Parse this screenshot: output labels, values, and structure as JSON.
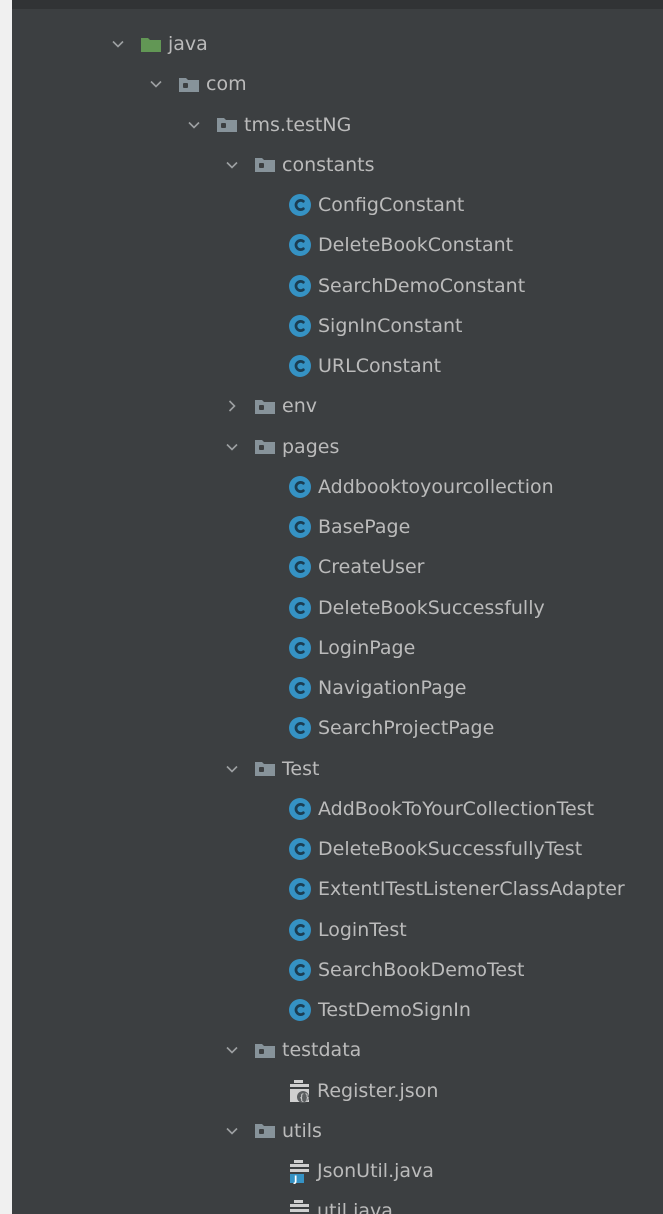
{
  "colors": {
    "background": "#3c3f41",
    "text": "#bbbbbb",
    "source_folder": "#629755",
    "package_folder": "#87939a",
    "class_icon": "#3592c4"
  },
  "tree": [
    {
      "label": "java",
      "kind": "source-folder",
      "depth": 0,
      "expanded": true
    },
    {
      "label": "com",
      "kind": "package",
      "depth": 1,
      "expanded": true
    },
    {
      "label": "tms.testNG",
      "kind": "package",
      "depth": 2,
      "expanded": true
    },
    {
      "label": "constants",
      "kind": "package",
      "depth": 3,
      "expanded": true
    },
    {
      "label": "ConfigConstant",
      "kind": "class",
      "depth": 4
    },
    {
      "label": "DeleteBookConstant",
      "kind": "class",
      "depth": 4
    },
    {
      "label": "SearchDemoConstant",
      "kind": "class",
      "depth": 4
    },
    {
      "label": "SignInConstant",
      "kind": "class",
      "depth": 4
    },
    {
      "label": "URLConstant",
      "kind": "class",
      "depth": 4
    },
    {
      "label": "env",
      "kind": "package",
      "depth": 3,
      "expanded": false
    },
    {
      "label": "pages",
      "kind": "package",
      "depth": 3,
      "expanded": true
    },
    {
      "label": "Addbooktoyourcollection",
      "kind": "class",
      "depth": 4
    },
    {
      "label": "BasePage",
      "kind": "class",
      "depth": 4
    },
    {
      "label": "CreateUser",
      "kind": "class",
      "depth": 4
    },
    {
      "label": "DeleteBookSuccessfully",
      "kind": "class",
      "depth": 4
    },
    {
      "label": "LoginPage",
      "kind": "class",
      "depth": 4
    },
    {
      "label": "NavigationPage",
      "kind": "class",
      "depth": 4
    },
    {
      "label": "SearchProjectPage",
      "kind": "class",
      "depth": 4
    },
    {
      "label": "Test",
      "kind": "package",
      "depth": 3,
      "expanded": true
    },
    {
      "label": "AddBookToYourCollectionTest",
      "kind": "class",
      "depth": 4
    },
    {
      "label": "DeleteBookSuccessfullyTest",
      "kind": "class",
      "depth": 4
    },
    {
      "label": "ExtentITestListenerClassAdapter",
      "kind": "class",
      "depth": 4
    },
    {
      "label": "LoginTest",
      "kind": "class",
      "depth": 4
    },
    {
      "label": "SearchBookDemoTest",
      "kind": "class",
      "depth": 4
    },
    {
      "label": "TestDemoSignIn",
      "kind": "class",
      "depth": 4
    },
    {
      "label": "testdata",
      "kind": "package",
      "depth": 3,
      "expanded": true
    },
    {
      "label": "Register.json",
      "kind": "json-file",
      "depth": 4
    },
    {
      "label": "utils",
      "kind": "package",
      "depth": 3,
      "expanded": true
    },
    {
      "label": "JsonUtil.java",
      "kind": "java-file",
      "depth": 4
    },
    {
      "label": "util.java",
      "kind": "java-file",
      "depth": 4
    }
  ]
}
